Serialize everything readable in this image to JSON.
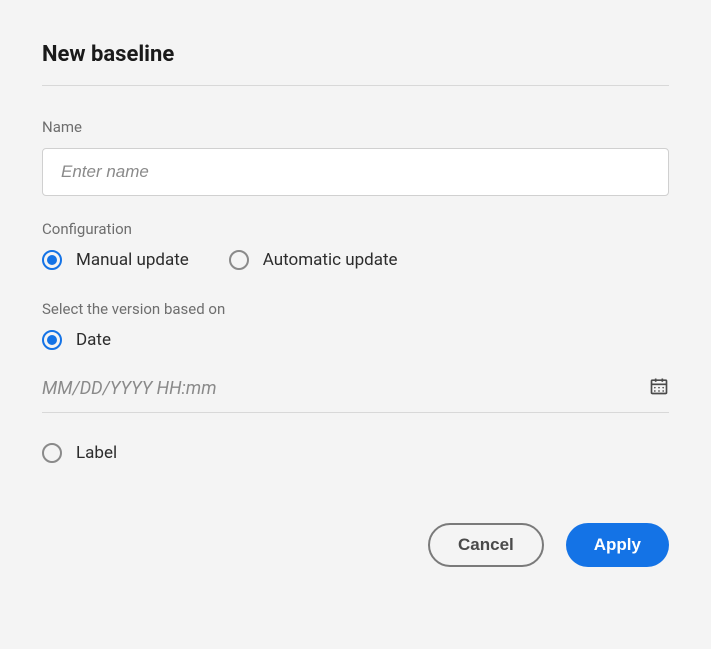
{
  "dialog": {
    "title": "New baseline"
  },
  "name_field": {
    "label": "Name",
    "placeholder": "Enter name",
    "value": ""
  },
  "configuration": {
    "label": "Configuration",
    "manual_label": "Manual update",
    "automatic_label": "Automatic update",
    "selected": "manual"
  },
  "version": {
    "label": "Select the version based on",
    "date_label": "Date",
    "label_label": "Label",
    "selected": "date",
    "date_placeholder": "MM/DD/YYYY HH:mm"
  },
  "buttons": {
    "cancel": "Cancel",
    "apply": "Apply"
  }
}
